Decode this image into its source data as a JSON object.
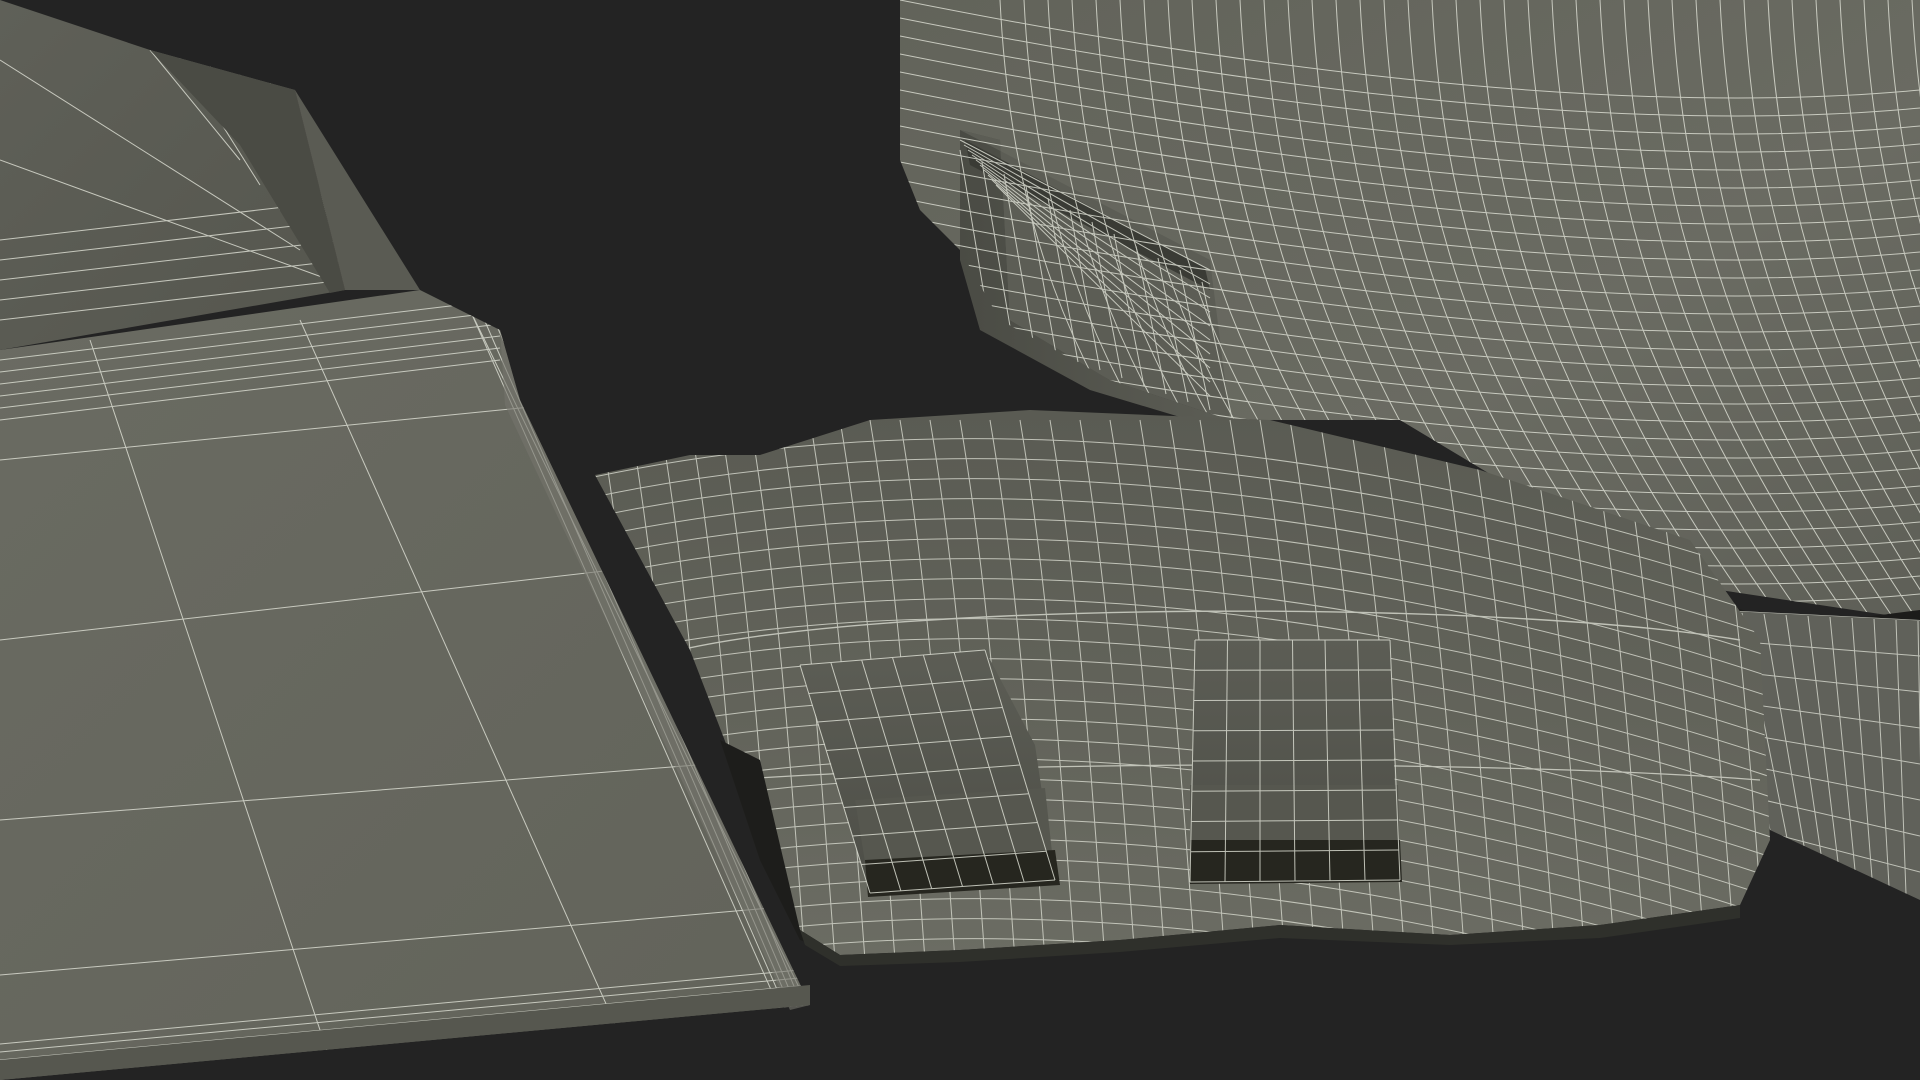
{
  "scene": {
    "description_visible_text": "",
    "colors": {
      "background": "#232323",
      "surface_light": "#6d6e65",
      "surface_mid": "#5a5b53",
      "surface_dark": "#46473f",
      "surface_shadow": "#2e2f2a",
      "wire": "#d9dbd0"
    },
    "objects": [
      {
        "name": "left-panel"
      },
      {
        "name": "base-plate"
      },
      {
        "name": "right-housing"
      },
      {
        "name": "right-foot"
      },
      {
        "name": "tab-left"
      },
      {
        "name": "tab-right"
      }
    ]
  }
}
